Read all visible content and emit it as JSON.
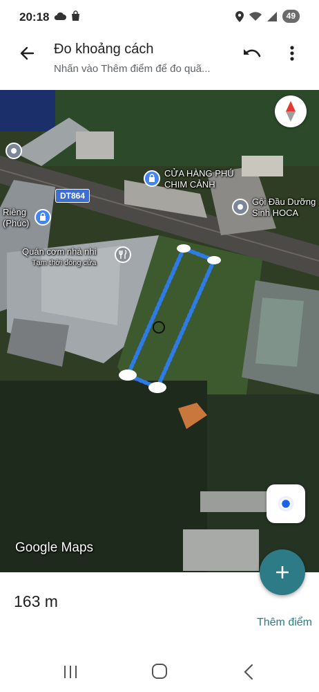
{
  "status_bar": {
    "time": "20:18",
    "battery": "49",
    "icons": [
      "cloud-icon",
      "shopping-bag-icon",
      "location-icon",
      "wifi-icon",
      "signal-icon"
    ]
  },
  "app_bar": {
    "title": "Đo khoảng cách",
    "subtitle": "Nhấn vào Thêm điểm để đo quã...",
    "back_icon": "arrow-back-icon",
    "undo_icon": "undo-icon",
    "more_icon": "more-vert-icon"
  },
  "map": {
    "road_shield": "DT864",
    "pois": [
      {
        "id": "poi-shop",
        "label_line1": "CỬA HÀNG PHÚ",
        "label_line2": "CHIM CẢNH"
      },
      {
        "id": "poi-hair",
        "label_line1": "Gội Đầu Dưỡng",
        "label_line2": "Sinh HOCA"
      },
      {
        "id": "poi-rieng",
        "label_line1": "Riêng",
        "label_line2": "(Phúc)"
      },
      {
        "id": "poi-restaurant",
        "label_line1": "Quán cơm nhà nhi",
        "label_line2": "Tạm thời đóng cửa"
      }
    ],
    "watermark": "Google Maps",
    "accent_color": "#2c7b86",
    "measure_color": "#2f7be6"
  },
  "measurement": {
    "distance": "163 m",
    "add_point_label": "Thêm điểm"
  },
  "fab": {
    "icon": "plus-icon"
  },
  "nav_bar": {
    "icons": [
      "recent-apps-icon",
      "home-icon",
      "back-nav-icon"
    ]
  }
}
